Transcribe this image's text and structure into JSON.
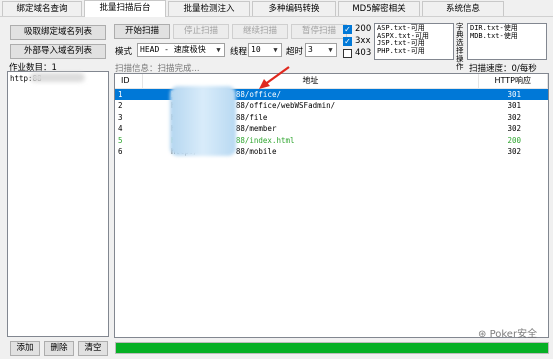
{
  "tabs": [
    {
      "label": "绑定域名查询"
    },
    {
      "label": "批量扫描后台",
      "active": true
    },
    {
      "label": "批量检测注入"
    },
    {
      "label": "多种编码转换"
    },
    {
      "label": "MD5解密相关"
    },
    {
      "label": "系统信息"
    }
  ],
  "left": {
    "fetch_button": "吸取绑定域名列表",
    "import_button": "外部导入域名列表",
    "queue_label": "作业数目：1",
    "queue_items": [
      "http:88"
    ],
    "add_button": "添加",
    "delete_button": "删除",
    "clear_button": "清空"
  },
  "toolbar": {
    "start": "开始扫描",
    "stop": "停止扫描",
    "resume": "继续扫描",
    "pause": "暂停扫描",
    "mode_label": "模式",
    "mode_value": "HEAD - 速度极快",
    "threads_label": "线程",
    "threads_value": "10",
    "timeout_label": "超时",
    "timeout_value": "3"
  },
  "status_filters": [
    {
      "label": "200",
      "checked": true
    },
    {
      "label": "3xx",
      "checked": true
    },
    {
      "label": "403",
      "checked": false
    }
  ],
  "dict_list_a": [
    "ASP.txt-可用",
    "ASPX.txt-可用",
    "JSP.txt-可用",
    "PHP.txt-可用"
  ],
  "dict_label": "字典选择操作",
  "dict_list_b": [
    "DIR.txt-使用",
    "MDB.txt-使用"
  ],
  "scan_info": "扫描信息：扫描完成...",
  "scan_speed": "扫描速度：0/每秒",
  "table": {
    "headers": [
      "ID",
      "地址",
      "HTTP响应"
    ],
    "rows": [
      {
        "id": "1",
        "url_prefix": "http:",
        "url_suffix": "88/office/",
        "code": "301",
        "selected": true
      },
      {
        "id": "2",
        "url_prefix": "http:",
        "url_suffix": "88/office/webWSFadmin/",
        "code": "301"
      },
      {
        "id": "3",
        "url_prefix": "http:",
        "url_suffix": "88/file",
        "code": "302"
      },
      {
        "id": "4",
        "url_prefix": "http:",
        "url_suffix": "88/member",
        "code": "302"
      },
      {
        "id": "5",
        "url_prefix": "http:",
        "url_suffix": "88/index.html",
        "code": "200",
        "green": true
      },
      {
        "id": "6",
        "url_prefix": "http:/",
        "url_suffix": "88/mobile",
        "code": "302"
      }
    ]
  },
  "progress": 1.0,
  "watermark": "Poker安全"
}
